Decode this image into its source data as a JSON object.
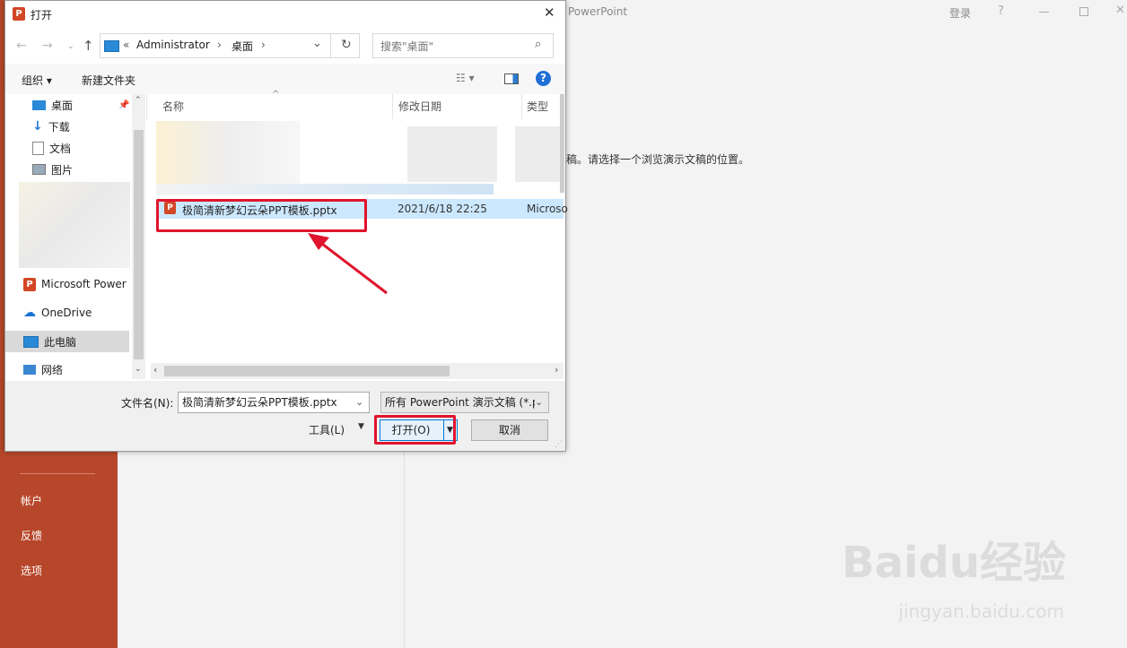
{
  "background_app": {
    "title": "PowerPoint",
    "login": "登录",
    "help": "?",
    "message": "稿。请选择一个浏览演示文稿的位置。",
    "side_items": [
      "帐户",
      "反馈",
      "选项"
    ],
    "watermark": "Baidu经验",
    "watermark_url": "jingyan.baidu.com"
  },
  "dialog": {
    "title": "打开",
    "breadcrumb": [
      "«",
      "Administrator",
      "›",
      "桌面",
      "›"
    ],
    "search_placeholder": "搜索\"桌面\"",
    "toolbar": {
      "organize": "组织 ▾",
      "new_folder": "新建文件夹"
    },
    "nav": {
      "quick": [
        {
          "label": "桌面",
          "icon": "desktop-icon"
        },
        {
          "label": "下载",
          "icon": "download-icon"
        },
        {
          "label": "文档",
          "icon": "document-icon"
        },
        {
          "label": "图片",
          "icon": "pictures-icon"
        }
      ],
      "microsoft_powerpoint": "Microsoft Power",
      "onedrive": "OneDrive",
      "this_pc": "此电脑",
      "network": "网络"
    },
    "columns": {
      "name": "名称",
      "date": "修改日期",
      "type": "类型"
    },
    "files": [
      {
        "name": "极简清新梦幻云朵PPT模板.pptx",
        "date": "2021/6/18 22:25",
        "type": "Microso"
      }
    ],
    "filename_label": "文件名(N):",
    "filename_value": "极简清新梦幻云朵PPT模板.pptx",
    "filetype_value": "所有 PowerPoint 演示文稿 (*.p",
    "tools_label": "工具(L)",
    "open_button": "打开(O)",
    "cancel_button": "取消"
  },
  "colors": {
    "ppt_red": "#b7472a",
    "highlight_red": "#e0142c",
    "selection": "#cce8ff"
  }
}
